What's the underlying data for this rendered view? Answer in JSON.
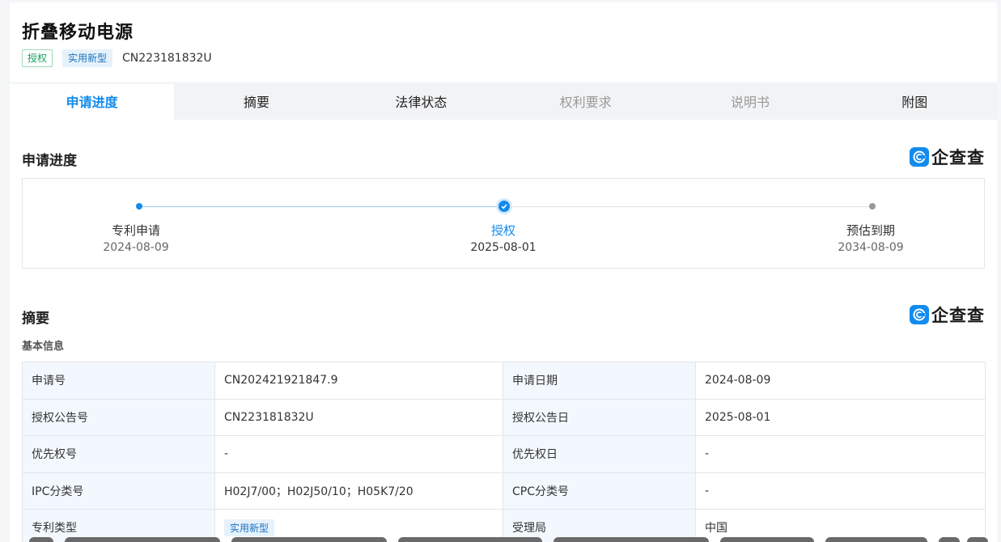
{
  "header": {
    "title": "折叠移动电源",
    "status_tag": "授权",
    "type_tag": "实用新型",
    "publication_number": "CN223181832U"
  },
  "tabs": [
    {
      "label": "申请进度",
      "active": true
    },
    {
      "label": "摘要"
    },
    {
      "label": "法律状态"
    },
    {
      "label": "权利要求",
      "disabled": true
    },
    {
      "label": "说明书",
      "disabled": true
    },
    {
      "label": "附图"
    }
  ],
  "brand": {
    "name": "企查查",
    "color": "#128bed"
  },
  "progress_section": {
    "title": "申请进度",
    "steps": [
      {
        "label": "专利申请",
        "date": "2024-08-09",
        "state": "done"
      },
      {
        "label": "授权",
        "date": "2025-08-01",
        "state": "current"
      },
      {
        "label": "预估到期",
        "date": "2034-08-09",
        "state": "pending"
      }
    ]
  },
  "abstract_section": {
    "title": "摘要",
    "subtitle": "基本信息",
    "rows": [
      {
        "l1": "申请号",
        "v1": "CN202421921847.9",
        "l2": "申请日期",
        "v2": "2024-08-09"
      },
      {
        "l1": "授权公告号",
        "v1": "CN223181832U",
        "l2": "授权公告日",
        "v2": "2025-08-01"
      },
      {
        "l1": "优先权号",
        "v1": "-",
        "l2": "优先权日",
        "v2": "-"
      },
      {
        "l1": "IPC分类号",
        "v1": "H02J7/00；H02J50/10；H05K7/20",
        "l2": "CPC分类号",
        "v2": "-"
      },
      {
        "l1": "专利类型",
        "v1": "实用新型",
        "l2": "受理局",
        "v2": "中国"
      }
    ]
  },
  "colors": {
    "accent": "#128bed",
    "status_green": "#17a05d",
    "label_bg": "#f2f8fe"
  }
}
